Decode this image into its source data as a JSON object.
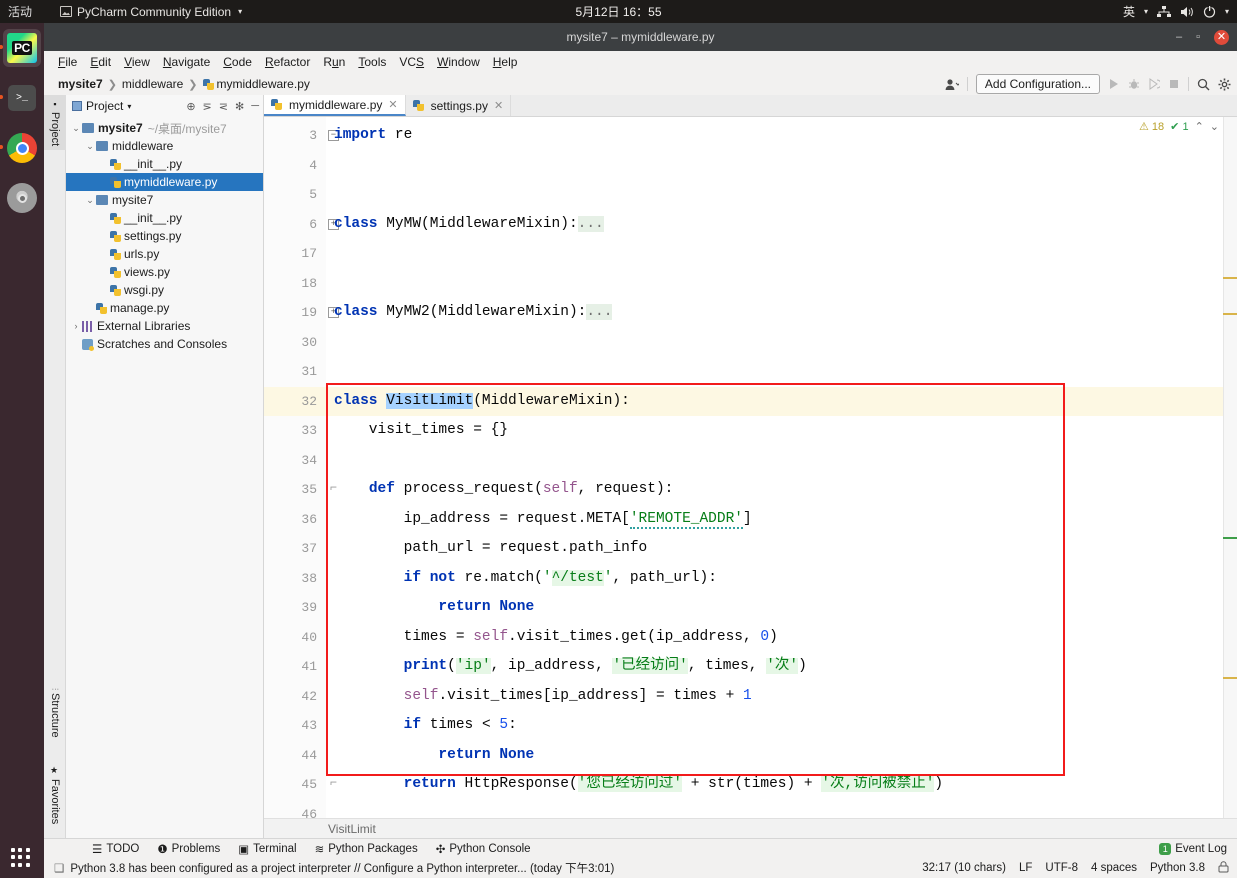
{
  "desktop": {
    "activities": "活动",
    "app_name": "PyCharm Community Edition",
    "clock": "5月12日  16：55",
    "input_method": "英",
    "dock": [
      {
        "name": "pycharm",
        "label": "PC"
      },
      {
        "name": "terminal",
        "label": ">_"
      },
      {
        "name": "chrome",
        "label": ""
      },
      {
        "name": "dvd",
        "label": "DVD"
      }
    ]
  },
  "window": {
    "title": "mysite7 – mymiddleware.py",
    "minimize": "–",
    "maximize": "▫",
    "close": "✕"
  },
  "menubar": [
    "File",
    "Edit",
    "View",
    "Navigate",
    "Code",
    "Refactor",
    "Run",
    "Tools",
    "VCS",
    "Window",
    "Help"
  ],
  "navbar": {
    "crumbs": [
      "mysite7",
      "middleware",
      "mymiddleware.py"
    ],
    "add_configuration": "Add Configuration...",
    "icons": [
      "user-icon",
      "run-icon",
      "debug-icon",
      "coverage-icon",
      "stop-icon",
      "search-icon",
      "settings-icon"
    ]
  },
  "toolstrip": {
    "top": "Project",
    "bottom": [
      "Structure",
      "Favorites"
    ]
  },
  "project": {
    "title": "Project",
    "header_icons": [
      "collapse-icon",
      "expand-icon",
      "sort-icon",
      "gear-icon",
      "hide-icon"
    ],
    "tree": [
      {
        "label": "mysite7",
        "sub": "~/桌面/mysite7",
        "indent": 0,
        "icon": "folder",
        "twist": "⌄",
        "bold": true,
        "selected": false
      },
      {
        "label": "middleware",
        "sub": "",
        "indent": 1,
        "icon": "folder",
        "twist": "⌄",
        "bold": false,
        "selected": false
      },
      {
        "label": "__init__.py",
        "sub": "",
        "indent": 2,
        "icon": "py",
        "twist": "",
        "bold": false,
        "selected": false
      },
      {
        "label": "mymiddleware.py",
        "sub": "",
        "indent": 2,
        "icon": "py",
        "twist": "",
        "bold": false,
        "selected": true
      },
      {
        "label": "mysite7",
        "sub": "",
        "indent": 1,
        "icon": "folder",
        "twist": "⌄",
        "bold": false,
        "selected": false
      },
      {
        "label": "__init__.py",
        "sub": "",
        "indent": 2,
        "icon": "py",
        "twist": "",
        "bold": false,
        "selected": false
      },
      {
        "label": "settings.py",
        "sub": "",
        "indent": 2,
        "icon": "py",
        "twist": "",
        "bold": false,
        "selected": false
      },
      {
        "label": "urls.py",
        "sub": "",
        "indent": 2,
        "icon": "py",
        "twist": "",
        "bold": false,
        "selected": false
      },
      {
        "label": "views.py",
        "sub": "",
        "indent": 2,
        "icon": "py",
        "twist": "",
        "bold": false,
        "selected": false
      },
      {
        "label": "wsgi.py",
        "sub": "",
        "indent": 2,
        "icon": "py",
        "twist": "",
        "bold": false,
        "selected": false
      },
      {
        "label": "manage.py",
        "sub": "",
        "indent": 1,
        "icon": "py",
        "twist": "",
        "bold": false,
        "selected": false
      },
      {
        "label": "External Libraries",
        "sub": "",
        "indent": 0,
        "icon": "lib",
        "twist": "›",
        "bold": false,
        "selected": false
      },
      {
        "label": "Scratches and Consoles",
        "sub": "",
        "indent": 0,
        "icon": "scratch",
        "twist": "",
        "bold": false,
        "selected": false
      }
    ]
  },
  "editor": {
    "tabs": [
      {
        "label": "mymiddleware.py",
        "active": true,
        "close": "✕"
      },
      {
        "label": "settings.py",
        "active": false,
        "close": "✕"
      }
    ],
    "inspection": {
      "warnings": "18",
      "checks": "1",
      "up": "⌃",
      "down": "⌄"
    },
    "breadcrumb": "VisitLimit",
    "lines": [
      {
        "num": "3",
        "fold": "minus",
        "hl": false
      },
      {
        "num": "4",
        "fold": "",
        "hl": false
      },
      {
        "num": "5",
        "fold": "",
        "hl": false
      },
      {
        "num": "6",
        "fold": "plus",
        "hl": false
      },
      {
        "num": "17",
        "fold": "",
        "hl": false
      },
      {
        "num": "18",
        "fold": "",
        "hl": false
      },
      {
        "num": "19",
        "fold": "plus",
        "hl": false
      },
      {
        "num": "30",
        "fold": "",
        "hl": false
      },
      {
        "num": "31",
        "fold": "",
        "hl": false
      },
      {
        "num": "32",
        "fold": "brace",
        "hl": true
      },
      {
        "num": "33",
        "fold": "",
        "hl": false
      },
      {
        "num": "34",
        "fold": "",
        "hl": false
      },
      {
        "num": "35",
        "fold": "brace",
        "hl": false
      },
      {
        "num": "36",
        "fold": "",
        "hl": false
      },
      {
        "num": "37",
        "fold": "",
        "hl": false
      },
      {
        "num": "38",
        "fold": "",
        "hl": false
      },
      {
        "num": "39",
        "fold": "",
        "hl": false
      },
      {
        "num": "40",
        "fold": "",
        "hl": false
      },
      {
        "num": "41",
        "fold": "",
        "hl": false
      },
      {
        "num": "42",
        "fold": "",
        "hl": false
      },
      {
        "num": "43",
        "fold": "",
        "hl": false
      },
      {
        "num": "44",
        "fold": "",
        "hl": false
      },
      {
        "num": "45",
        "fold": "brace",
        "hl": false
      },
      {
        "num": "46",
        "fold": "",
        "hl": false
      }
    ],
    "code_text": [
      "import re",
      "",
      "",
      "class MyMW(MiddlewareMixin):...",
      "",
      "",
      "class MyMW2(MiddlewareMixin):...",
      "",
      "",
      "class VisitLimit(MiddlewareMixin):",
      "    visit_times = {}",
      "",
      "    def process_request(self, request):",
      "        ip_address = request.META['REMOTE_ADDR']",
      "        path_url = request.path_info",
      "        if not re.match('^/test', path_url):",
      "            return None",
      "        times = self.visit_times.get(ip_address, 0)",
      "        print('ip', ip_address, '已经访问', times, '次')",
      "        self.visit_times[ip_address] = times + 1",
      "        if times < 5:",
      "            return None",
      "        return HttpResponse('您已经访问过' + str(times) + '次,访问被禁止')",
      ""
    ]
  },
  "bottom_tools": [
    {
      "label": "TODO",
      "icon": "list-icon"
    },
    {
      "label": "Problems",
      "icon": "error-icon"
    },
    {
      "label": "Terminal",
      "icon": "terminal-icon"
    },
    {
      "label": "Python Packages",
      "icon": "packages-icon"
    },
    {
      "label": "Python Console",
      "icon": "console-icon"
    }
  ],
  "event_log": {
    "count": "1",
    "label": "Event Log"
  },
  "statusbar": {
    "message": "Python 3.8 has been configured as a project interpreter // Configure a Python interpreter... (today 下午3:01)",
    "caret": "32:17 (10 chars)",
    "line_sep": "LF",
    "encoding": "UTF-8",
    "indent": "4 spaces",
    "interpreter": "Python 3.8",
    "lock": "🔒"
  },
  "colors": {
    "accent": "#2675bf",
    "highlight_box": "#f21b1b",
    "line_highlight": "#fdf8e3",
    "keyword": "#0033b3",
    "string": "#067d17",
    "number": "#1750eb",
    "self": "#94558d"
  }
}
